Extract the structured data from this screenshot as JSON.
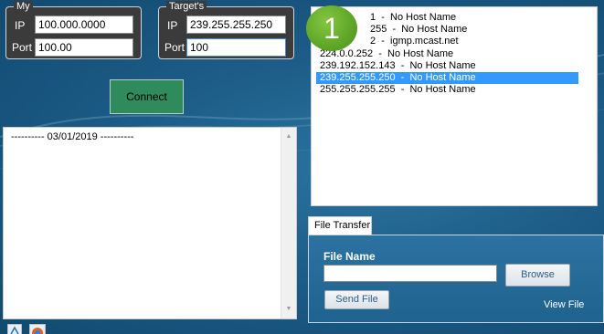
{
  "my_group": {
    "legend": "My",
    "ip_label": "IP",
    "ip_value": "100.000.0000",
    "port_label": "Port",
    "port_value": "100.00"
  },
  "target_group": {
    "legend": "Target's",
    "ip_label": "IP",
    "ip_value": "239.255.255.250",
    "port_label": "Port",
    "port_value": "100"
  },
  "connect_label": "Connect",
  "log": {
    "text": "---------- 03/01/2019 ----------"
  },
  "badge": "1",
  "hosts": [
    "1  -  No Host Name",
    "255  -  No Host Name",
    "2  -  igmp.mcast.net",
    "224.0.0.252  -  No Host Name",
    "239.192.152.143  -  No Host Name",
    "239.255.255.250  -  No Host Name",
    "255.255.255.255  -  No Host Name"
  ],
  "selected_host_index": 5,
  "file_transfer": {
    "tab_label": "File Transfer",
    "file_name_label": "File Name",
    "file_name_value": "",
    "browse_label": "Browse",
    "send_label": "Send File",
    "view_label": "View File"
  },
  "icons": {
    "scroll_up": "scroll-up-icon",
    "scroll_down": "scroll-down-icon",
    "clear": "clear-icon",
    "color": "color-wheel-icon"
  },
  "colors": {
    "background": "#1d5d88",
    "group_box": "#3b3b3b",
    "connect_button": "#2f8a5c",
    "selection": "#3399ff",
    "badge": "#5ea628"
  }
}
